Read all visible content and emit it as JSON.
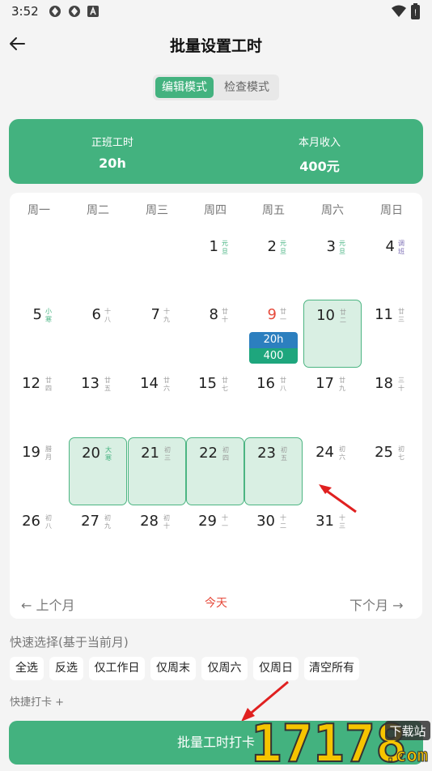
{
  "status": {
    "time": "3:52",
    "battery_label": "!"
  },
  "header": {
    "title": "批量设置工时"
  },
  "mode": {
    "edit_label": "编辑模式",
    "check_label": "检查模式"
  },
  "summary": {
    "left_label": "正班工时",
    "left_value": "20h",
    "right_label": "本月收入",
    "right_value": "400元"
  },
  "calendar": {
    "weekdays": [
      "周一",
      "周二",
      "周三",
      "周四",
      "周五",
      "周六",
      "周日"
    ],
    "days": [
      {
        "d": "1",
        "l": "元旦",
        "c": "g",
        "r": 0,
        "col": 3
      },
      {
        "d": "2",
        "l": "元旦",
        "c": "g",
        "r": 0,
        "col": 4
      },
      {
        "d": "3",
        "l": "元旦",
        "c": "g",
        "r": 0,
        "col": 5
      },
      {
        "d": "4",
        "l": "调班",
        "c": "p",
        "r": 0,
        "col": 6
      },
      {
        "d": "5",
        "l": "小寒",
        "c": "g",
        "r": 1,
        "col": 0
      },
      {
        "d": "6",
        "l": "十八",
        "c": "",
        "r": 1,
        "col": 1
      },
      {
        "d": "7",
        "l": "十九",
        "c": "",
        "r": 1,
        "col": 2
      },
      {
        "d": "8",
        "l": "廿十",
        "c": "",
        "r": 1,
        "col": 3
      },
      {
        "d": "9",
        "l": "廿一",
        "c": "",
        "r": 1,
        "col": 4,
        "red": true
      },
      {
        "d": "10",
        "l": "廿二",
        "c": "",
        "r": 1,
        "col": 5,
        "sel": true
      },
      {
        "d": "11",
        "l": "廿三",
        "c": "",
        "r": 1,
        "col": 6
      },
      {
        "d": "12",
        "l": "廿四",
        "c": "",
        "r": 2,
        "col": 0
      },
      {
        "d": "13",
        "l": "廿五",
        "c": "",
        "r": 2,
        "col": 1
      },
      {
        "d": "14",
        "l": "廿六",
        "c": "",
        "r": 2,
        "col": 2
      },
      {
        "d": "15",
        "l": "廿七",
        "c": "",
        "r": 2,
        "col": 3
      },
      {
        "d": "16",
        "l": "廿八",
        "c": "",
        "r": 2,
        "col": 4
      },
      {
        "d": "17",
        "l": "廿九",
        "c": "",
        "r": 2,
        "col": 5
      },
      {
        "d": "18",
        "l": "三十",
        "c": "",
        "r": 2,
        "col": 6
      },
      {
        "d": "19",
        "l": "腊月",
        "c": "",
        "r": 3,
        "col": 0
      },
      {
        "d": "20",
        "l": "大寒",
        "c": "g",
        "r": 3,
        "col": 1,
        "sel": true
      },
      {
        "d": "21",
        "l": "初三",
        "c": "",
        "r": 3,
        "col": 2,
        "sel": true
      },
      {
        "d": "22",
        "l": "初四",
        "c": "",
        "r": 3,
        "col": 3,
        "sel": true
      },
      {
        "d": "23",
        "l": "初五",
        "c": "",
        "r": 3,
        "col": 4,
        "sel": true
      },
      {
        "d": "24",
        "l": "初六",
        "c": "",
        "r": 3,
        "col": 5
      },
      {
        "d": "25",
        "l": "初七",
        "c": "",
        "r": 3,
        "col": 6
      },
      {
        "d": "26",
        "l": "初八",
        "c": "",
        "r": 4,
        "col": 0
      },
      {
        "d": "27",
        "l": "初九",
        "c": "",
        "r": 4,
        "col": 1
      },
      {
        "d": "28",
        "l": "初十",
        "c": "",
        "r": 4,
        "col": 2
      },
      {
        "d": "29",
        "l": "十一",
        "c": "",
        "r": 4,
        "col": 3
      },
      {
        "d": "30",
        "l": "十二",
        "c": "",
        "r": 4,
        "col": 4
      },
      {
        "d": "31",
        "l": "十三",
        "c": "",
        "r": 4,
        "col": 5
      }
    ],
    "day9_hours": "20h",
    "day9_income": "400",
    "prev_label": "上个月",
    "today_label": "今天",
    "next_label": "下个月"
  },
  "quick": {
    "title": "快速选择(基于当前月)",
    "chips": [
      "全选",
      "反选",
      "仅工作日",
      "仅周末",
      "仅周六",
      "仅周日",
      "清空所有"
    ],
    "punch_label": "快捷打卡 +"
  },
  "bottom": {
    "punch_button": "批量工时打卡"
  },
  "watermark": {
    "text": "17178",
    "suffix": ".com",
    "tag": "下载站"
  },
  "colors": {
    "accent": "#43b27f",
    "blue_tag": "#2c7fbf",
    "red": "#e64a3b",
    "selected_bg": "#d9efe3"
  }
}
